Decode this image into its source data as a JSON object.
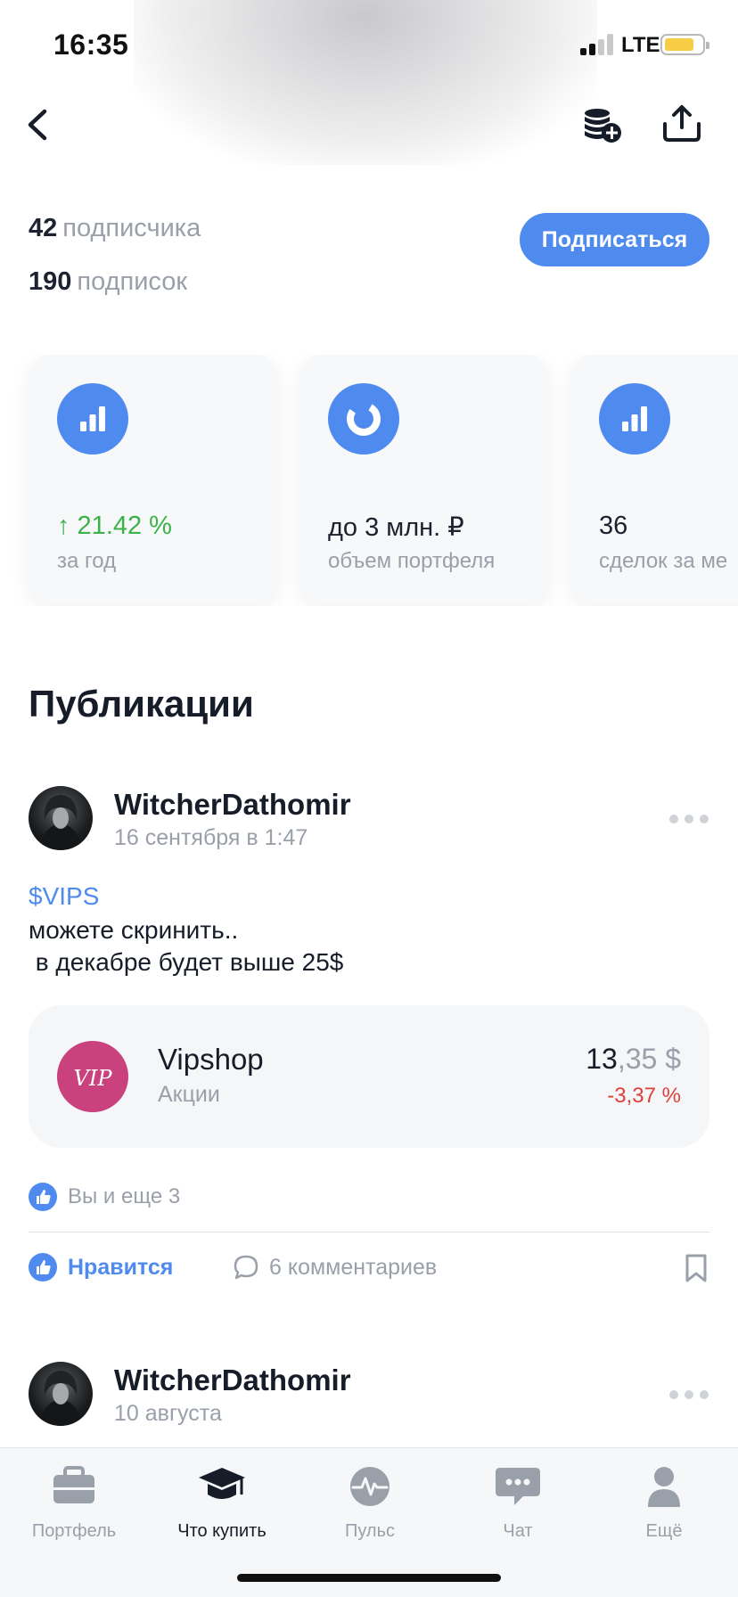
{
  "status_bar": {
    "time": "16:35",
    "network": "LTE"
  },
  "header": {
    "back_icon": "chevron-left-icon",
    "add_coins_icon": "coins-plus-icon",
    "share_icon": "share-upload-icon"
  },
  "profile": {
    "followers_count": "42",
    "followers_label": "подписчика",
    "following_count": "190",
    "following_label": "подписок",
    "subscribe_label": "Подписаться"
  },
  "stat_cards": [
    {
      "icon": "bar-chart-icon",
      "value": "↑ 21.42 %",
      "caption": "за год",
      "value_color": "#3cb24a"
    },
    {
      "icon": "donut-chart-icon",
      "value": "до 3 млн. ₽",
      "caption": "объем портфеля"
    },
    {
      "icon": "bar-chart-icon",
      "value": "36",
      "caption": "сделок за ме"
    }
  ],
  "section_title": "Публикации",
  "posts": [
    {
      "author": "WitcherDathomir",
      "date": "16 сентября в 1:47",
      "ticker": "$VIPS",
      "text": "можете скринить..\n в декабре будет выше 25$",
      "stock": {
        "logo_text": "VIP",
        "name": "Vipshop",
        "type": "Акции",
        "price_int": "13",
        "price_dec": ",35 $",
        "change": "-3,37 %"
      },
      "likes_text": "Вы и еще 3",
      "like_label": "Нравится",
      "comments_label": "6 комментариев"
    },
    {
      "author": "WitcherDathomir",
      "date": "10 августа"
    }
  ],
  "tabbar": [
    {
      "label": "Портфель",
      "icon": "briefcase-icon"
    },
    {
      "label": "Что купить",
      "icon": "graduation-cap-icon",
      "active": true
    },
    {
      "label": "Пульс",
      "icon": "pulse-icon"
    },
    {
      "label": "Чат",
      "icon": "chat-bubble-icon"
    },
    {
      "label": "Ещё",
      "icon": "profile-icon"
    }
  ],
  "colors": {
    "accent": "#4f8bee",
    "positive": "#3cb24a",
    "negative": "#e0403a",
    "vipshop": "#c9417d"
  }
}
